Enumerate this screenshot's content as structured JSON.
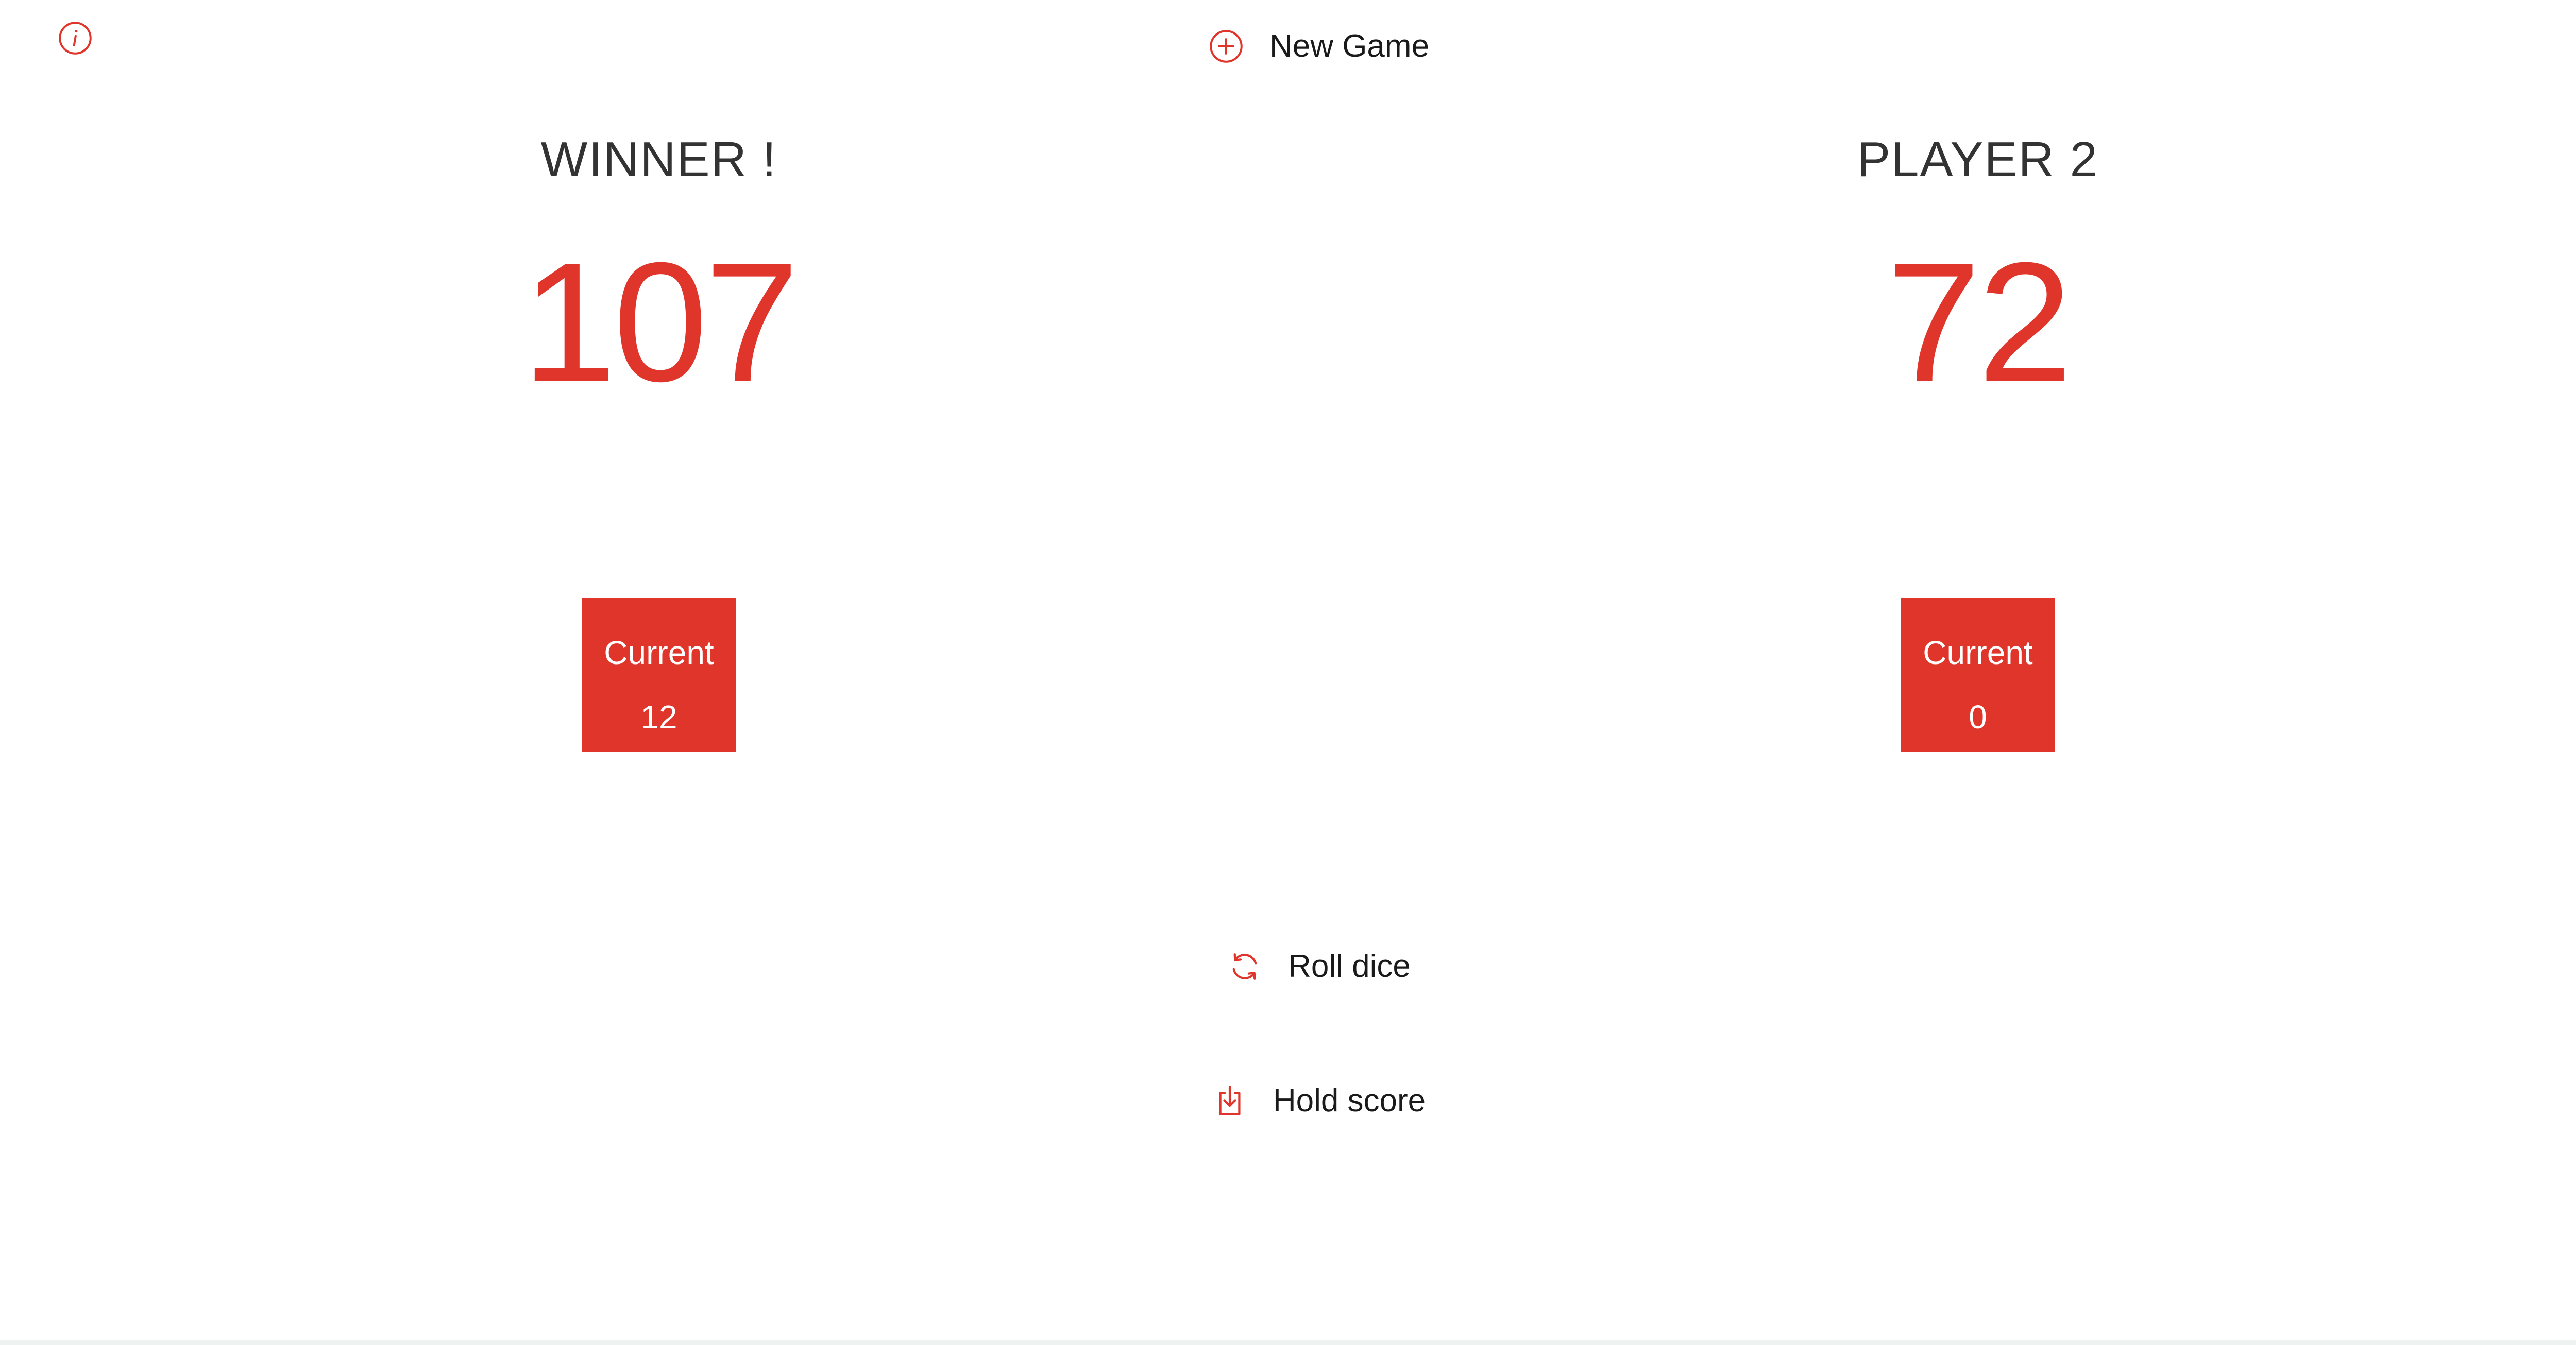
{
  "app": {
    "accent_color": "#e0352b",
    "background_color": "#ffffff"
  },
  "controls": {
    "info_icon": "info-circle-icon",
    "new_game": {
      "label": "New Game",
      "icon": "plus-circle-icon"
    },
    "roll_dice": {
      "label": "Roll dice",
      "icon": "refresh-icon"
    },
    "hold_score": {
      "label": "Hold score",
      "icon": "download-box-icon"
    }
  },
  "players": [
    {
      "name": "WINNER !",
      "score": "107",
      "current_label": "Current",
      "current_score": "12",
      "is_winner": true
    },
    {
      "name": "PLAYER 2",
      "score": "72",
      "current_label": "Current",
      "current_score": "0",
      "is_winner": false
    }
  ]
}
